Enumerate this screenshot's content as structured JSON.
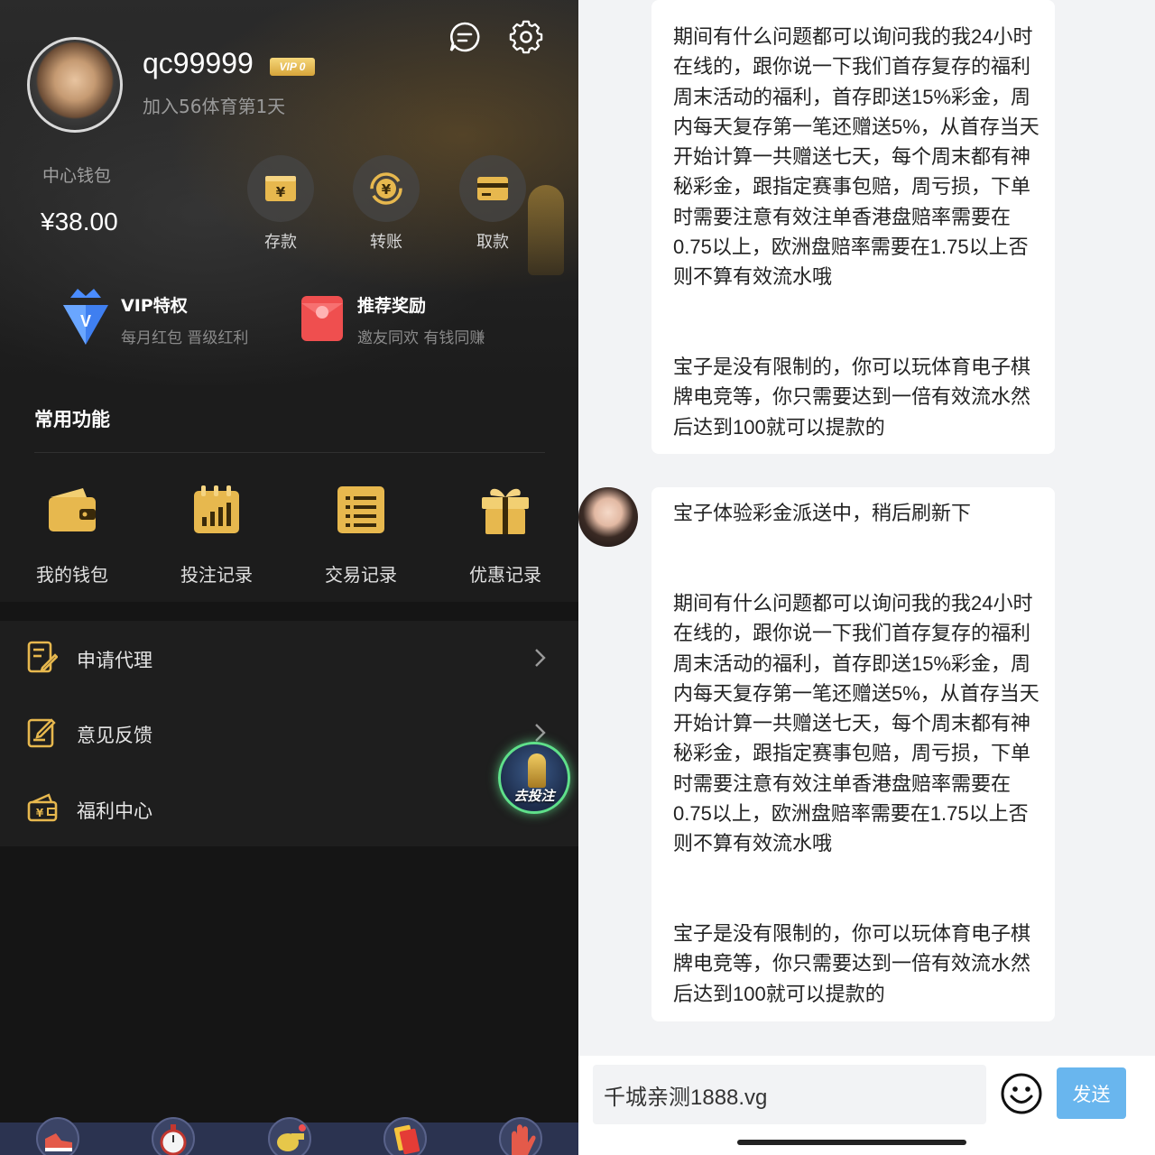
{
  "profile": {
    "username": "qc99999",
    "vip_badge": "VIP 0",
    "join_text": "加入56体育第1天"
  },
  "wallet": {
    "label": "中心钱包",
    "balance": "¥38.00",
    "actions": [
      {
        "label": "存款",
        "icon": "deposit-icon"
      },
      {
        "label": "转账",
        "icon": "transfer-icon"
      },
      {
        "label": "取款",
        "icon": "withdraw-icon"
      }
    ]
  },
  "perks": [
    {
      "title": "VIP特权",
      "subtitle": "每月红包 晋级红利",
      "icon": "vip-diamond-icon"
    },
    {
      "title": "推荐奖励",
      "subtitle": "邀友同欢 有钱同赚",
      "icon": "red-envelope-icon"
    }
  ],
  "common_functions": {
    "title": "常用功能",
    "items": [
      {
        "label": "我的钱包",
        "icon": "wallet-icon"
      },
      {
        "label": "投注记录",
        "icon": "bet-record-icon"
      },
      {
        "label": "交易记录",
        "icon": "transaction-record-icon"
      },
      {
        "label": "优惠记录",
        "icon": "gift-icon"
      }
    ]
  },
  "menu": [
    {
      "label": "申请代理",
      "icon": "apply-agent-icon"
    },
    {
      "label": "意见反馈",
      "icon": "feedback-icon"
    },
    {
      "label": "福利中心",
      "icon": "welfare-icon"
    }
  ],
  "float_button": {
    "label": "去投注"
  },
  "bottom_nav": [
    "shoe-icon",
    "stopwatch-icon",
    "whistle-icon",
    "red-card-icon",
    "goalkeeper-glove-icon"
  ],
  "chat": {
    "messages": [
      {
        "paragraphs": [
          "期间有什么问题都可以询问我的我24小时在线的，跟你说一下我们首存复存的福利周末活动的福利，首存即送15%彩金，周内每天复存第一笔还赠送5%，从首存当天开始计算一共赠送七天，每个周末都有神秘彩金，跟指定赛事包赔，周亏损，下单时需要注意有效注单香港盘赔率需要在0.75以上，欧洲盘赔率需要在1.75以上否则不算有效流水哦",
          "宝子是没有限制的，你可以玩体育电子棋牌电竞等，你只需要达到一倍有效流水然后达到100就可以提款的"
        ]
      },
      {
        "paragraphs": [
          "宝子体验彩金派送中，稍后刷新下",
          "期间有什么问题都可以询问我的我24小时在线的，跟你说一下我们首存复存的福利周末活动的福利，首存即送15%彩金，周内每天复存第一笔还赠送5%，从首存当天开始计算一共赠送七天，每个周末都有神秘彩金，跟指定赛事包赔，周亏损，下单时需要注意有效注单香港盘赔率需要在0.75以上，欧洲盘赔率需要在1.75以上否则不算有效流水哦",
          "宝子是没有限制的，你可以玩体育电子棋牌电竞等，你只需要达到一倍有效流水然后达到100就可以提款的"
        ]
      }
    ],
    "input_value": "千城亲测1888.vg",
    "send_label": "发送"
  },
  "colors": {
    "gold": "#e7b84e",
    "send_blue": "#69b6ee",
    "float_green": "#5fe08a"
  }
}
